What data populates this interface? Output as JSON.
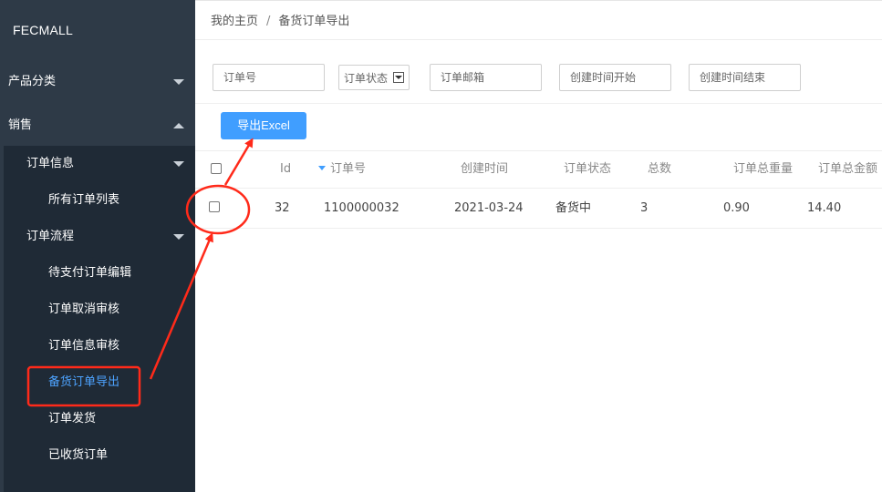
{
  "sidebar": {
    "logo": "FECMALL",
    "top_items": [
      {
        "label": "产品分类",
        "expanded": false
      },
      {
        "label": "销售",
        "expanded": true
      }
    ],
    "groups": [
      {
        "label": "订单信息",
        "expanded": true,
        "items": [
          "所有订单列表"
        ]
      },
      {
        "label": "订单流程",
        "expanded": true,
        "items": [
          "待支付订单编辑",
          "订单取消审核",
          "订单信息审核",
          "备货订单导出",
          "订单发货",
          "已收货订单"
        ]
      }
    ],
    "active_item": "备货订单导出"
  },
  "breadcrumb": {
    "home": "我的主页",
    "separator": "/",
    "current": "备货订单导出"
  },
  "filters": {
    "order_no": "订单号",
    "order_status": "订单状态",
    "order_email": "订单邮箱",
    "created_start": "创建时间开始",
    "created_end": "创建时间结束"
  },
  "toolbar": {
    "export_label": "导出Excel"
  },
  "table": {
    "columns": [
      "Id",
      "订单号",
      "创建时间",
      "订单状态",
      "总数",
      "订单总重量",
      "订单总金额"
    ],
    "sorted_column": "订单号",
    "rows": [
      {
        "id": "32",
        "order_no": "1100000032",
        "created": "2021-03-24",
        "status": "备货中",
        "count": "3",
        "weight": "0.90",
        "amount": "14.40"
      }
    ]
  },
  "colors": {
    "accent": "#409eff",
    "sidebar_bg": "#2e3a47",
    "submenu_bg": "#1f2a36",
    "annotation": "#ff2a1a"
  }
}
